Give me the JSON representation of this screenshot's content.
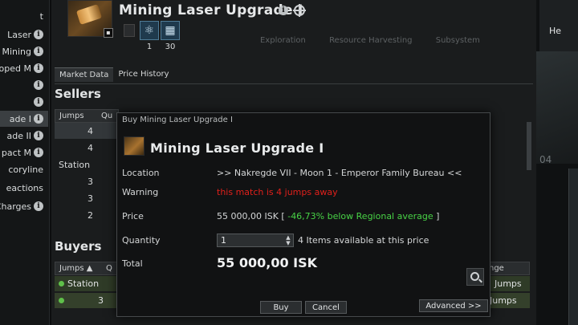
{
  "sidebar": {
    "items": [
      {
        "label": "t",
        "info": false,
        "selected": false
      },
      {
        "label": "Laser",
        "info": true,
        "selected": false
      },
      {
        "label": "Mining",
        "info": true,
        "selected": false
      },
      {
        "label": "oped M",
        "info": true,
        "selected": false
      },
      {
        "label": "",
        "info": true,
        "selected": false
      },
      {
        "label": "",
        "info": true,
        "selected": false
      },
      {
        "label": "ade I",
        "info": true,
        "selected": true
      },
      {
        "label": "ade II",
        "info": true,
        "selected": false
      },
      {
        "label": "pact M",
        "info": true,
        "selected": false
      },
      {
        "label": "coryline",
        "info": false,
        "selected": false
      },
      {
        "label": "eactions",
        "info": false,
        "selected": false
      },
      {
        "label": "Charges",
        "info": true,
        "selected": false
      }
    ],
    "info_glyph": "i"
  },
  "item": {
    "title": "Mining Laser Upgrade I",
    "icon_tag": "▪",
    "skill_counts": [
      "1",
      "30"
    ]
  },
  "tabs": [
    {
      "label": "Market Data",
      "active": true
    },
    {
      "label": "Price History",
      "active": false
    }
  ],
  "background_headers": [
    "Exploration",
    "Resource Harvesting",
    "Subsystem"
  ],
  "sellers": {
    "title": "Sellers",
    "columns": [
      "Jumps",
      "Qu"
    ],
    "rows": [
      "4",
      "4",
      "Station",
      "3",
      "3",
      "2"
    ]
  },
  "buyers": {
    "title": "Buyers",
    "columns": [
      "Jumps ▲",
      "Q"
    ],
    "right_column": "nge",
    "rows": [
      {
        "jumps": "Station",
        "range": "Jumps"
      },
      {
        "jumps": "3",
        "range": "Jumps"
      }
    ]
  },
  "right_panel": {
    "label": "He",
    "num": "04"
  },
  "dialog": {
    "title": "Buy Mining Laser Upgrade I",
    "item_title": "Mining Laser Upgrade I",
    "location_label": "Location",
    "location_value": ">> Nakregde VII - Moon 1 - Emperor Family Bureau <<",
    "warning_label": "Warning",
    "warning_value": "this match is 4 jumps away",
    "price_label": "Price",
    "price_value": "55 000,00 ISK [",
    "price_delta": "-46,73% below Regional average",
    "price_close": "]",
    "quantity_label": "Quantity",
    "quantity_value": "1",
    "quantity_note": "4 Items available at this price",
    "total_label": "Total",
    "total_value": "55 000,00 ISK",
    "buy_label": "Buy",
    "cancel_label": "Cancel",
    "advanced_label": "Advanced  >>"
  },
  "colors": {
    "warning": "#e0201b",
    "positive": "#48d346",
    "buyer_row": "#2f3b27"
  }
}
